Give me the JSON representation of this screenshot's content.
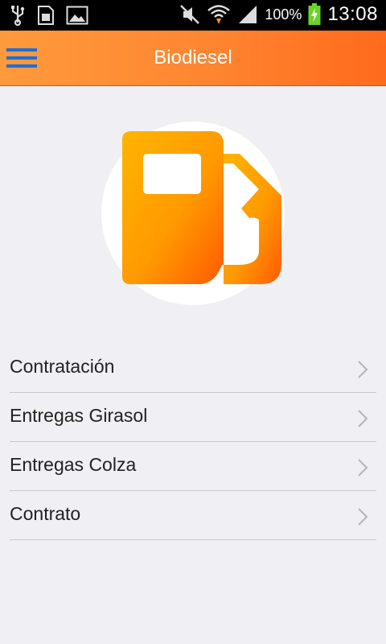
{
  "status_bar": {
    "battery": "100%",
    "time": "13:08",
    "left_icons": [
      "usb-icon",
      "sim-icon",
      "image-icon"
    ],
    "right_icons": [
      "mute-icon",
      "wifi-icon",
      "signal-icon",
      "battery-charging-icon"
    ]
  },
  "app_bar": {
    "title": "Biodiesel",
    "menu_icon": "hamburger-menu-icon",
    "menu_icon_color": "#1e6fd9"
  },
  "hero": {
    "icon": "fuel-pump-icon",
    "colors": {
      "start": "#ffb400",
      "end": "#ff5a00",
      "circle": "#ffffff"
    }
  },
  "menu": {
    "items": [
      {
        "label": "Contratación"
      },
      {
        "label": "Entregas Girasol"
      },
      {
        "label": "Entregas Colza"
      },
      {
        "label": "Contrato"
      }
    ]
  },
  "colors": {
    "background": "#efeff4",
    "accent": "#ff8530",
    "divider": "#c8c8cc"
  }
}
